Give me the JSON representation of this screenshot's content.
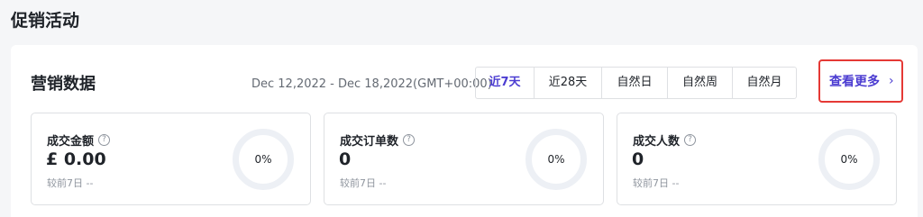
{
  "page": {
    "title": "促销活动"
  },
  "marketing": {
    "title": "营销数据",
    "date_range": "Dec 12,2022 - Dec 18,2022(GMT+00:00)",
    "tabs": [
      {
        "label": "近7天",
        "active": true
      },
      {
        "label": "近28天",
        "active": false
      },
      {
        "label": "自然日",
        "active": false
      },
      {
        "label": "自然周",
        "active": false
      },
      {
        "label": "自然月",
        "active": false
      }
    ],
    "more_label": "查看更多",
    "more_icon": "chevron-right-icon",
    "help_icon": "question-circle-icon",
    "metrics": [
      {
        "label": "成交金额",
        "value": "£ 0.00",
        "compare": "较前7日 --",
        "percent": "0%"
      },
      {
        "label": "成交订单数",
        "value": "0",
        "compare": "较前7日 --",
        "percent": "0%"
      },
      {
        "label": "成交人数",
        "value": "0",
        "compare": "较前7日 --",
        "percent": "0%"
      }
    ]
  },
  "colors": {
    "accent": "#4b3cd1",
    "highlight_border": "#e53935",
    "background": "#f5f6f8"
  }
}
